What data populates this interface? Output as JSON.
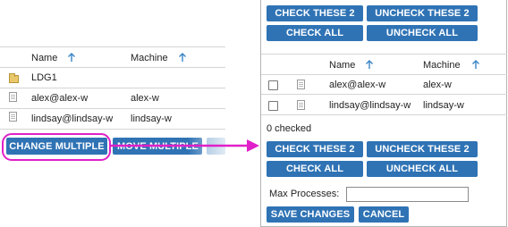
{
  "colors": {
    "button_bg": "#2f73b5",
    "arrow": "#e020c8",
    "highlight_ring": "#e020c8",
    "sort_arrow": "#3a86c6"
  },
  "left": {
    "headers": {
      "name": "Name",
      "machine": "Machine"
    },
    "rows": [
      {
        "icon": "folder-icon",
        "name": "LDG1",
        "machine": ""
      },
      {
        "icon": "file-icon",
        "name": "alex@alex-w",
        "machine": "alex-w"
      },
      {
        "icon": "file-icon",
        "name": "lindsay@lindsay-w",
        "machine": "lindsay-w"
      }
    ],
    "buttons": {
      "change_multiple": "CHANGE MULTIPLE",
      "move_multiple": "MOVE MULTIPLE"
    }
  },
  "right": {
    "top_buttons": {
      "check_these": "CHECK THESE 2",
      "uncheck_these": "UNCHECK THESE 2",
      "check_all": "CHECK ALL",
      "uncheck_all": "UNCHECK ALL"
    },
    "headers": {
      "name": "Name",
      "machine": "Machine"
    },
    "rows": [
      {
        "icon": "file-icon",
        "name": "alex@alex-w",
        "machine": "alex-w",
        "checked": false
      },
      {
        "icon": "file-icon",
        "name": "lindsay@lindsay-w",
        "machine": "lindsay-w",
        "checked": false
      }
    ],
    "status": "0 checked",
    "bottom_buttons": {
      "check_these": "CHECK THESE 2",
      "uncheck_these": "UNCHECK THESE 2",
      "check_all": "CHECK ALL",
      "uncheck_all": "UNCHECK ALL"
    },
    "max_processes": {
      "label": "Max Processes:",
      "value": ""
    },
    "save_changes": "SAVE CHANGES",
    "cancel": "CANCEL"
  }
}
